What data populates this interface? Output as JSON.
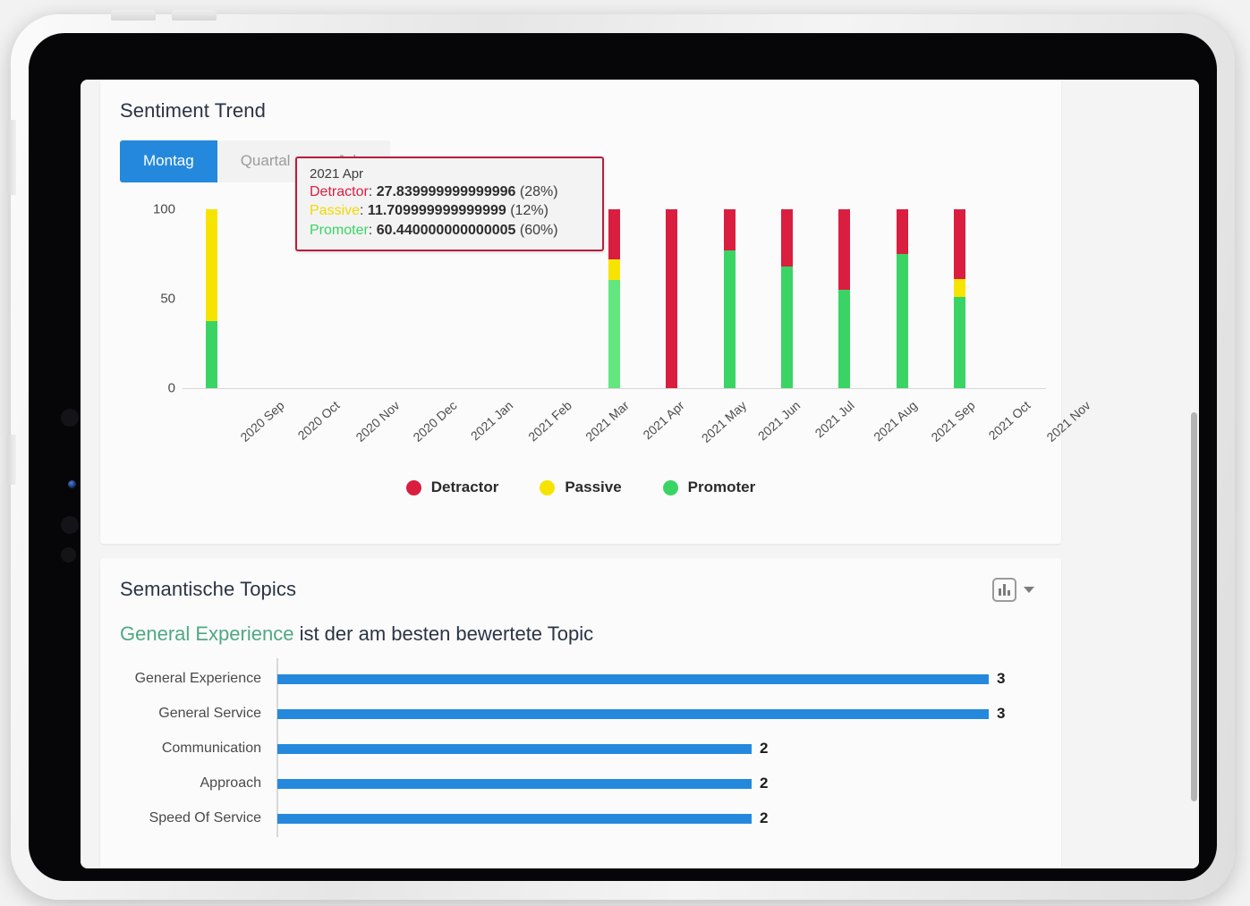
{
  "sentiment_card": {
    "title": "Sentiment Trend",
    "tabs": [
      {
        "label": "Montag",
        "active": true
      },
      {
        "label": "Quartal",
        "active": false
      },
      {
        "label": "Jahr",
        "active": false
      }
    ],
    "tooltip": {
      "date": "2021 Apr",
      "rows": [
        {
          "key": "Detractor",
          "value": "27.839999999999996",
          "percent": "(28%)",
          "color": "#da1e40"
        },
        {
          "key": "Passive",
          "value": "11.709999999999999",
          "percent": "(12%)",
          "color": "#f2d900"
        },
        {
          "key": "Promoter",
          "value": "60.440000000000005",
          "percent": "(60%)",
          "color": "#3ad465"
        }
      ]
    },
    "legend": [
      {
        "label": "Detractor",
        "color": "#da1e40"
      },
      {
        "label": "Passive",
        "color": "#f6e400"
      },
      {
        "label": "Promoter",
        "color": "#3ad465"
      }
    ]
  },
  "topics_card": {
    "title": "Semantische Topics",
    "chart_type_icon": "bar-chart-icon",
    "headline_highlight": "General Experience",
    "headline_rest": " ist der am besten bewertete Topic"
  },
  "chart_data": [
    {
      "id": "sentiment-trend",
      "type": "bar",
      "stacked": true,
      "title": "Sentiment Trend",
      "xlabel": "",
      "ylabel": "",
      "ylim": [
        0,
        100
      ],
      "yticks": [
        0,
        50,
        100
      ],
      "grid": false,
      "legend_position": "bottom",
      "categories": [
        "2020 Sep",
        "2020 Oct",
        "2020 Nov",
        "2020 Dec",
        "2021 Jan",
        "2021 Feb",
        "2021 Mar",
        "2021 Apr",
        "2021 May",
        "2021 Jun",
        "2021 Jul",
        "2021 Aug",
        "2021 Sep",
        "2021 Oct",
        "2021 Nov"
      ],
      "series": [
        {
          "name": "Promoter",
          "color": "#3ad465",
          "values": [
            37.5,
            0,
            0,
            0,
            0,
            0,
            0,
            60.44,
            0,
            77,
            68,
            55,
            75,
            51,
            0
          ]
        },
        {
          "name": "Passive",
          "color": "#f6e400",
          "values": [
            62.5,
            0,
            0,
            0,
            0,
            0,
            0,
            11.71,
            0,
            0,
            0,
            0,
            0,
            10,
            0
          ]
        },
        {
          "name": "Detractor",
          "color": "#da1e40",
          "values": [
            0,
            0,
            0,
            0,
            0,
            0,
            0,
            27.84,
            100,
            23,
            32,
            45,
            25,
            39,
            0
          ]
        }
      ],
      "hovered_category": "2021 Apr"
    },
    {
      "id": "semantic-topics",
      "type": "bar",
      "orientation": "horizontal",
      "title": "Semantische Topics",
      "xlabel": "",
      "ylabel": "",
      "xlim": [
        0,
        3
      ],
      "grid": false,
      "bar_color": "#2489dd",
      "categories": [
        "General Experience",
        "General Service",
        "Communication",
        "Approach",
        "Speed Of Service"
      ],
      "values": [
        3,
        3,
        2,
        2,
        2
      ],
      "value_labels": [
        "3",
        "3",
        "2",
        "2",
        "2"
      ]
    }
  ]
}
